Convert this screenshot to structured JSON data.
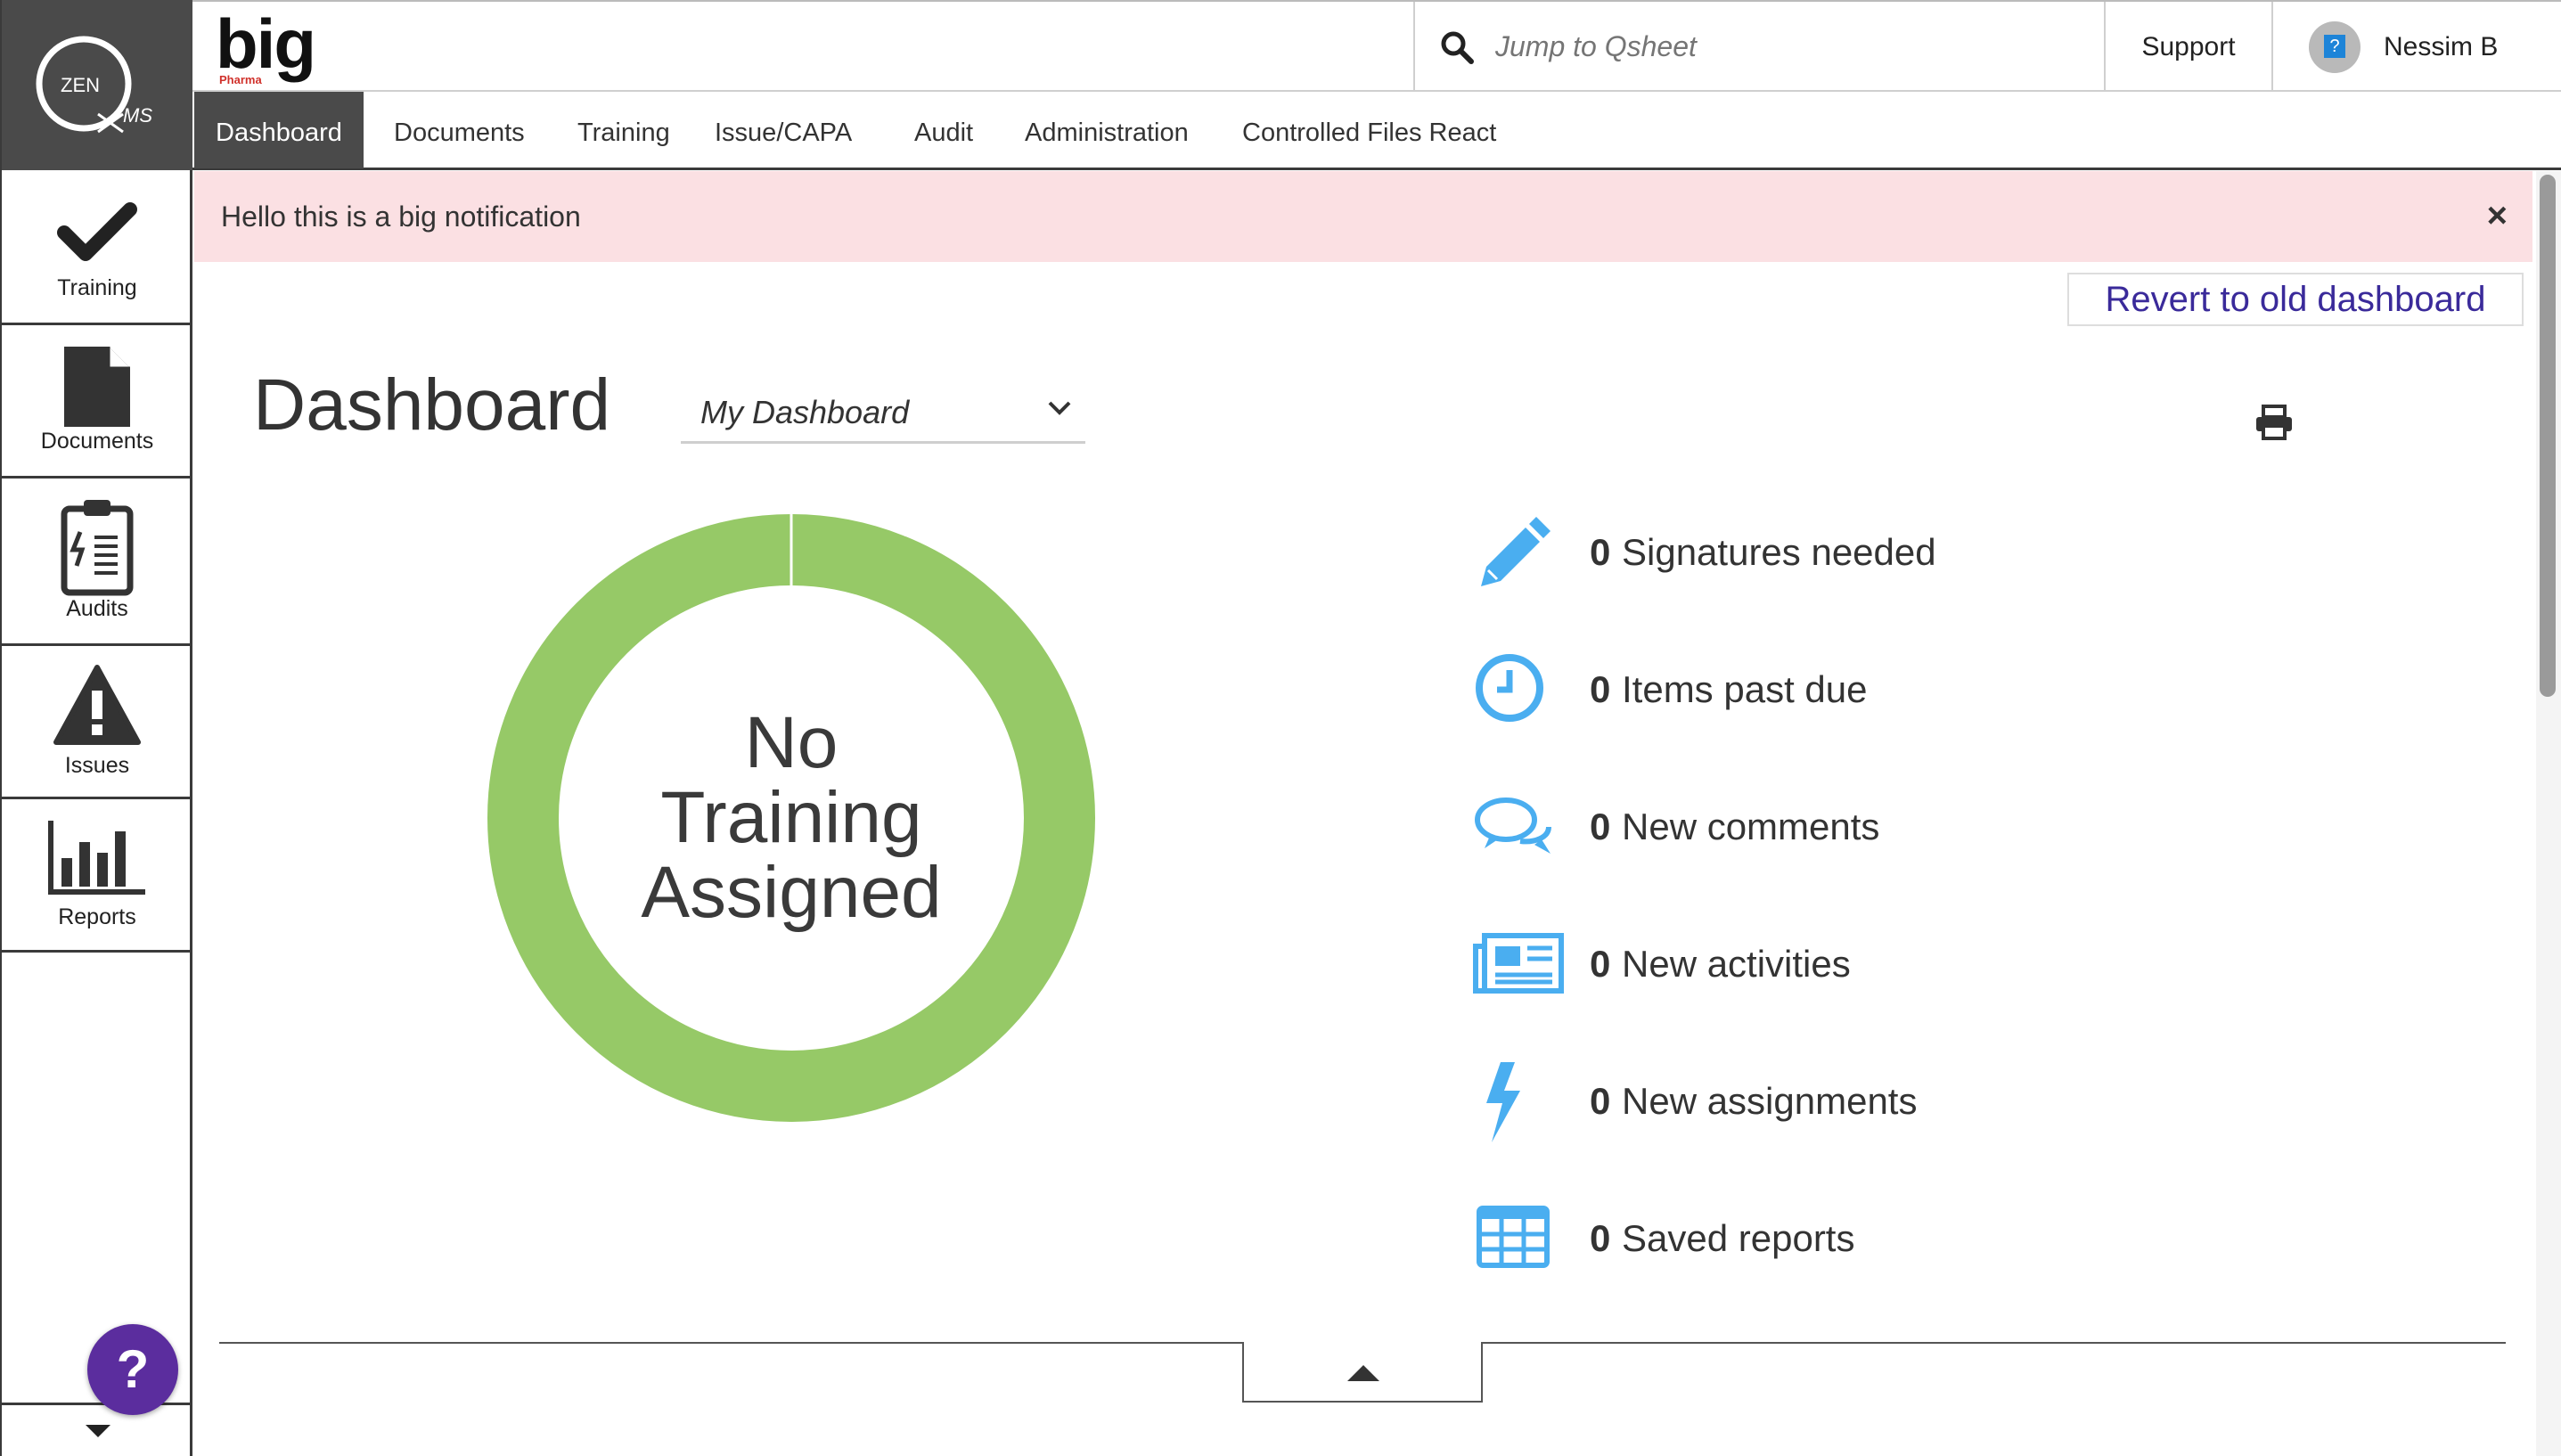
{
  "sidebar": {
    "logo_text": "ZEN QMS",
    "items": [
      {
        "label": "Training",
        "icon": "checkmark-icon"
      },
      {
        "label": "Documents",
        "icon": "document-icon"
      },
      {
        "label": "Audits",
        "icon": "clipboard-icon"
      },
      {
        "label": "Issues",
        "icon": "warning-icon"
      },
      {
        "label": "Reports",
        "icon": "bar-chart-icon"
      }
    ],
    "help_label": "?"
  },
  "header": {
    "brand": "big",
    "brand_sub": "Pharma",
    "search_placeholder": "Jump to Qsheet",
    "support_label": "Support",
    "user_name": "Nessim B",
    "avatar_glyph": "?"
  },
  "nav": {
    "tabs": [
      {
        "label": "Dashboard",
        "active": true
      },
      {
        "label": "Documents",
        "active": false
      },
      {
        "label": "Training",
        "active": false
      },
      {
        "label": "Issue/CAPA",
        "active": false
      },
      {
        "label": "Audit",
        "active": false
      },
      {
        "label": "Administration",
        "active": false
      },
      {
        "label": "Controlled Files React",
        "active": false
      }
    ]
  },
  "notification": {
    "text": "Hello this is a big notification",
    "close_glyph": "×"
  },
  "main": {
    "revert_label": "Revert to old dashboard",
    "title": "Dashboard",
    "dashboard_select_value": "My Dashboard",
    "donut_text": [
      "No",
      "Training",
      "Assigned"
    ],
    "stats": [
      {
        "count": "0",
        "label": "Signatures needed",
        "icon": "pencil-icon"
      },
      {
        "count": "0",
        "label": "Items past due",
        "icon": "clock-icon"
      },
      {
        "count": "0",
        "label": "New comments",
        "icon": "comments-icon"
      },
      {
        "count": "0",
        "label": "New activities",
        "icon": "newspaper-icon"
      },
      {
        "count": "0",
        "label": "New assignments",
        "icon": "lightning-icon"
      },
      {
        "count": "0",
        "label": "Saved reports",
        "icon": "table-grid-icon"
      }
    ]
  },
  "colors": {
    "accent_green": "#96c967",
    "icon_blue": "#4aaef0",
    "notice_bg": "#fbe0e3",
    "dark_gray": "#4a4a4a",
    "help_purple": "#5b2d9e",
    "link_indigo": "#3a2a9a"
  }
}
